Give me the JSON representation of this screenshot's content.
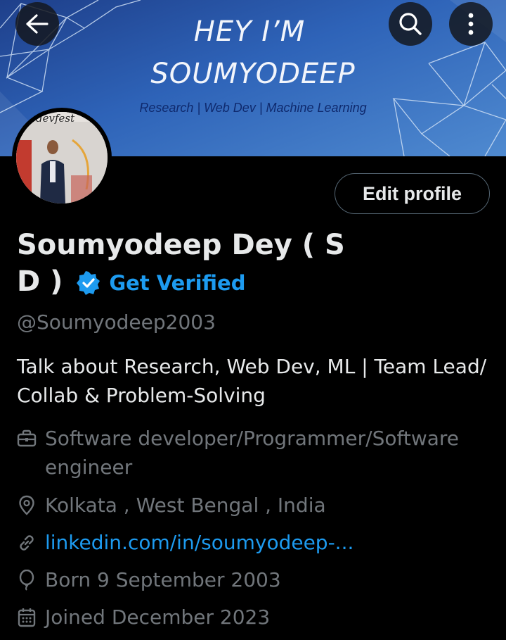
{
  "banner": {
    "line1": "HEY I’M",
    "line2": "SOUMYODEEP",
    "tagline": "Research | Web Dev | Machine Learning"
  },
  "profile": {
    "name": "Soumyodeep Dey ( S D )",
    "get_verified": "Get Verified",
    "handle": "@Soumyodeep2003",
    "bio": "Talk about Research, Web Dev, ML | Team Lead/ Collab & Problem-Solving",
    "edit_label": "Edit profile",
    "avatar_text": "devfest"
  },
  "details": [
    {
      "icon": "briefcase-icon",
      "text": "Software developer/Programmer/Software engineer"
    },
    {
      "icon": "location-icon",
      "text": "Kolkata , West Bengal , India"
    },
    {
      "icon": "link-icon",
      "text": "linkedin.com/in/soumyodeep-..."
    },
    {
      "icon": "balloon-icon",
      "text": "Born 9 September 2003"
    },
    {
      "icon": "calendar-icon",
      "text": "Joined December 2023"
    }
  ],
  "colors": {
    "accent": "#1d9bf0",
    "muted": "#71767b",
    "background": "#000000"
  }
}
